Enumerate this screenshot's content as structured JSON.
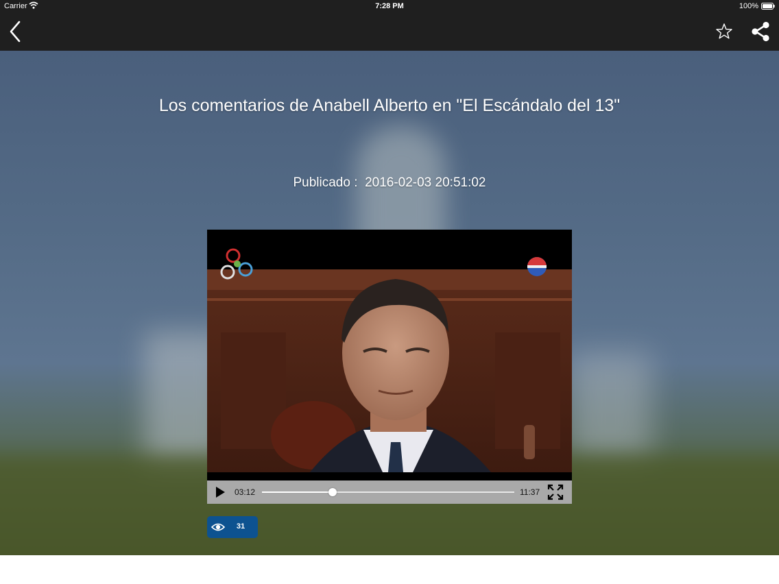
{
  "status_bar": {
    "carrier": "Carrier",
    "time": "7:28 PM",
    "battery": "100%"
  },
  "nav": {
    "back_icon": "chevron-left-icon",
    "favorite_icon": "star-outline-icon",
    "share_icon": "share-icon"
  },
  "article": {
    "title": "Los comentarios de Anabell Alberto en \"El Escándalo del 13\"",
    "published_label": "Publicado :",
    "published_value": "2016-02-03 20:51:02"
  },
  "player": {
    "current_time": "03:12",
    "duration": "11:37",
    "progress": 0.28,
    "play_icon": "play-icon",
    "fullscreen_icon": "fullscreen-icon"
  },
  "views": {
    "icon": "eye-icon",
    "count": "31"
  },
  "colors": {
    "bar_background": "#1f1f1f",
    "badge_background": "#0d5290",
    "controls_background": "#a9a9a9"
  }
}
